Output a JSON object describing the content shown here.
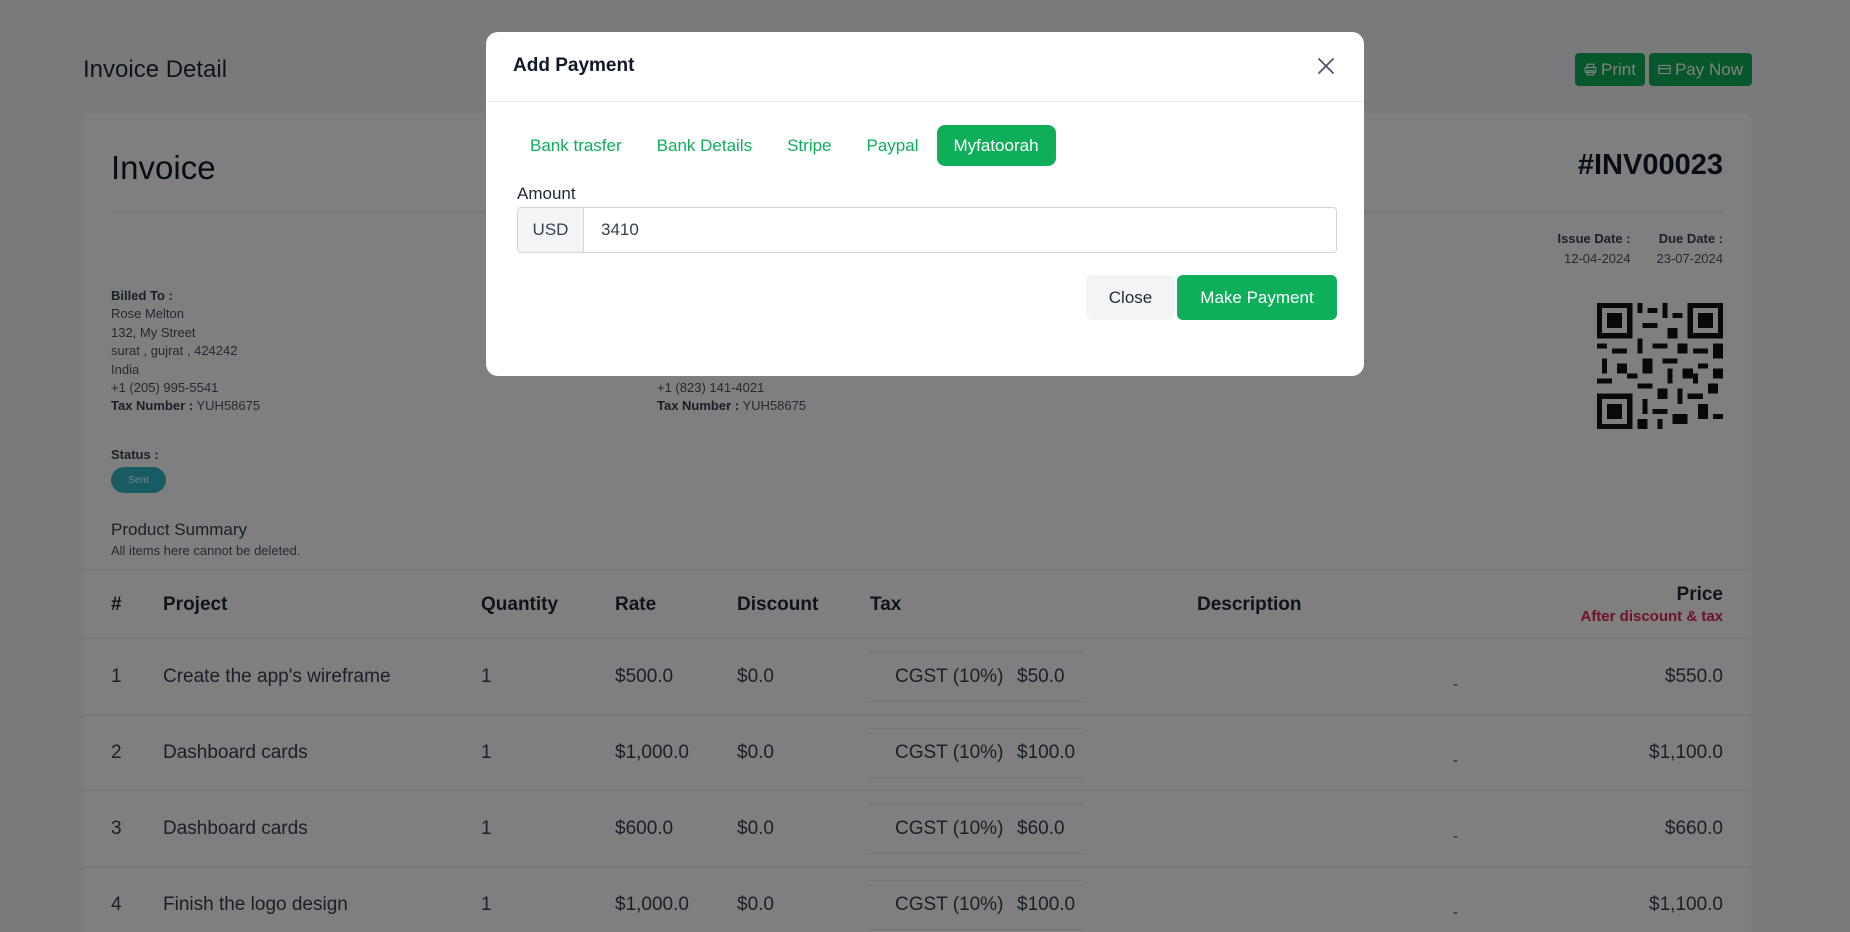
{
  "page": {
    "title": "Invoice Detail",
    "print_label": "Print",
    "pay_now_label": "Pay Now"
  },
  "invoice": {
    "title": "Invoice",
    "number": "#INV00023",
    "issue_date_label": "Issue Date :",
    "issue_date": "12-04-2024",
    "due_date_label": "Due Date :",
    "due_date": "23-07-2024",
    "billed_to": {
      "label": "Billed To :",
      "name": "Rose Melton",
      "street": "132, My Street",
      "city": "surat , gujrat , 424242",
      "country": "India",
      "phone": "+1 (205) 995-5541",
      "tax_label": "Tax Number :",
      "tax_number": "YUH58675"
    },
    "shipped_to": {
      "phone": "+1 (823) 141-4021",
      "tax_label": "Tax Number :",
      "tax_number": "YUH58675"
    },
    "status_label": "Status :",
    "status": "Sent",
    "product_summary_title": "Product Summary",
    "product_summary_sub": "All items here cannot be deleted."
  },
  "table": {
    "headers": {
      "num": "#",
      "project": "Project",
      "quantity": "Quantity",
      "rate": "Rate",
      "discount": "Discount",
      "tax": "Tax",
      "description": "Description",
      "price": "Price",
      "price_sub": "After discount & tax"
    },
    "rows": [
      {
        "num": "1",
        "project": "Create the app's wireframe",
        "quantity": "1",
        "rate": "$500.0",
        "discount": "$0.0",
        "tax_name": "CGST (10%)",
        "tax_amount": "$50.0",
        "description": "-",
        "price": "$550.0"
      },
      {
        "num": "2",
        "project": "Dashboard cards",
        "quantity": "1",
        "rate": "$1,000.0",
        "discount": "$0.0",
        "tax_name": "CGST (10%)",
        "tax_amount": "$100.0",
        "description": "-",
        "price": "$1,100.0"
      },
      {
        "num": "3",
        "project": "Dashboard cards",
        "quantity": "1",
        "rate": "$600.0",
        "discount": "$0.0",
        "tax_name": "CGST (10%)",
        "tax_amount": "$60.0",
        "description": "-",
        "price": "$660.0"
      },
      {
        "num": "4",
        "project": "Finish the logo design",
        "quantity": "1",
        "rate": "$1,000.0",
        "discount": "$0.0",
        "tax_name": "CGST (10%)",
        "tax_amount": "$100.0",
        "description": "-",
        "price": "$1,100.0"
      }
    ]
  },
  "modal": {
    "title": "Add Payment",
    "tabs": [
      {
        "label": "Bank trasfer",
        "active": false
      },
      {
        "label": "Bank Details",
        "active": false
      },
      {
        "label": "Stripe",
        "active": false
      },
      {
        "label": "Paypal",
        "active": false
      },
      {
        "label": "Myfatoorah",
        "active": true
      }
    ],
    "amount_label": "Amount",
    "currency": "USD",
    "amount_value": "3410",
    "close_label": "Close",
    "make_payment_label": "Make Payment"
  },
  "colors": {
    "accent": "#0fae5b",
    "status_badge": "#30b6c6",
    "price_sub": "#dc2654"
  },
  "icons": {
    "print": "printer-icon",
    "pay_now": "credit-card-icon",
    "close": "close-icon",
    "qr": "qr-code"
  }
}
